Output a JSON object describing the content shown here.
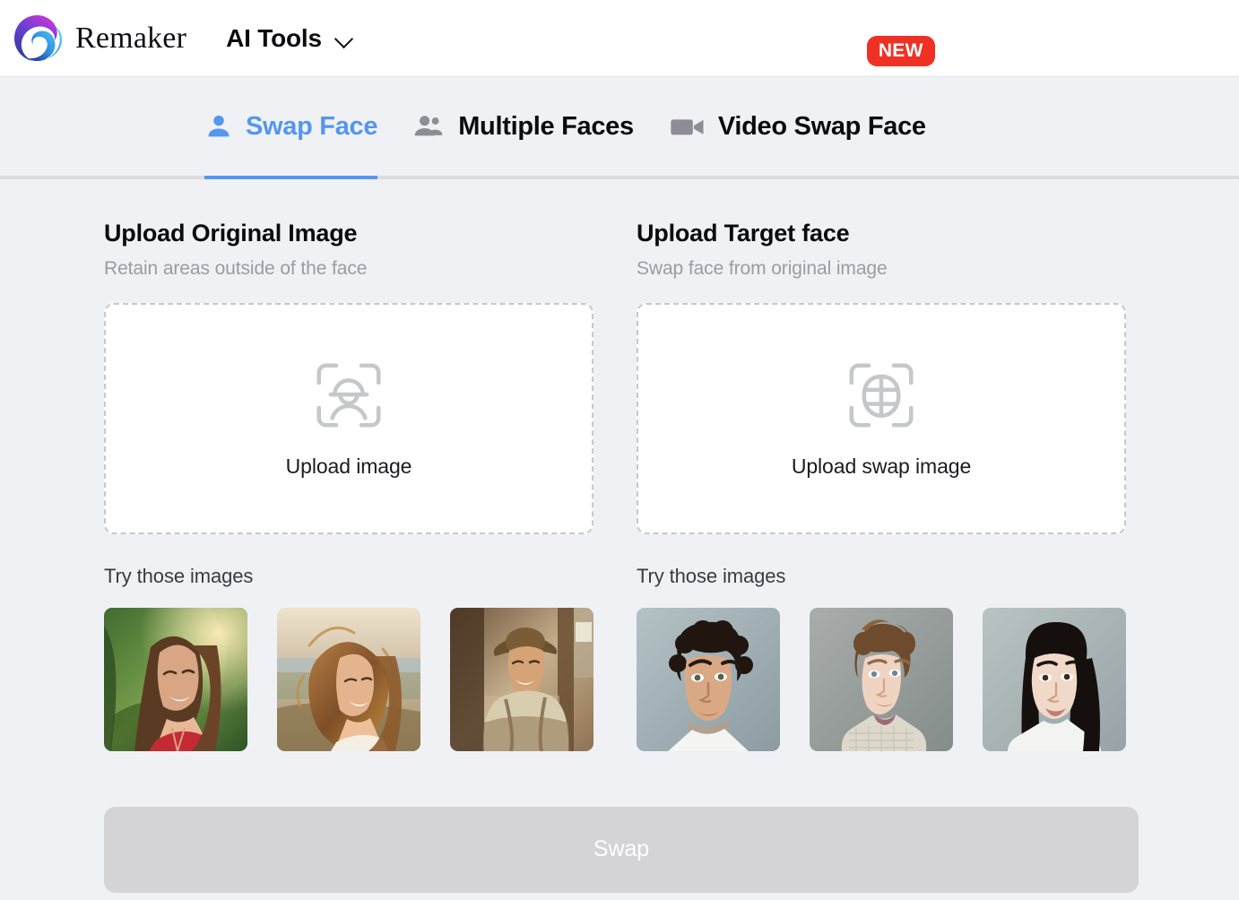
{
  "header": {
    "brand_name": "Remaker",
    "logo_icon": "remaker-swirl-logo",
    "nav": {
      "label": "AI Tools",
      "chevron_icon": "chevron-down-icon"
    }
  },
  "tabs": [
    {
      "label": "Swap Face",
      "icon": "single-person-icon",
      "active": true,
      "badge": null
    },
    {
      "label": "Multiple Faces",
      "icon": "two-people-icon",
      "active": false,
      "badge": null
    },
    {
      "label": "Video Swap Face",
      "icon": "video-camera-icon",
      "active": false,
      "badge": "NEW"
    }
  ],
  "panels": {
    "original": {
      "title": "Upload Original Image",
      "subtitle": "Retain areas outside of the face",
      "dropzone": {
        "icon": "face-scan-icon",
        "text": "Upload image"
      },
      "try_label": "Try those images",
      "samples": [
        {
          "alt": "woman-in-red-top-tropical"
        },
        {
          "alt": "woman-windswept-hair-beach"
        },
        {
          "alt": "cowboy-western-street"
        }
      ]
    },
    "target": {
      "title": "Upload Target face",
      "subtitle": "Swap face from original image",
      "dropzone": {
        "icon": "face-mesh-scan-icon",
        "text": "Upload swap image"
      },
      "try_label": "Try those images",
      "samples": [
        {
          "alt": "man-curly-dark-hair-portrait"
        },
        {
          "alt": "woman-auburn-updo-portrait"
        },
        {
          "alt": "woman-long-black-hair-portrait"
        }
      ]
    }
  },
  "action": {
    "swap_label": "Swap",
    "disabled": true
  },
  "colors": {
    "page_background": "#f0f1f5",
    "header_background": "#ffffff",
    "accent_blue": "#5496f0",
    "badge_red": "#ef3124",
    "muted_text": "#9b9ba1",
    "dropzone_border": "#c7c8cd",
    "swap_button": "#d4d4d6",
    "divider": "#dcdcde"
  }
}
